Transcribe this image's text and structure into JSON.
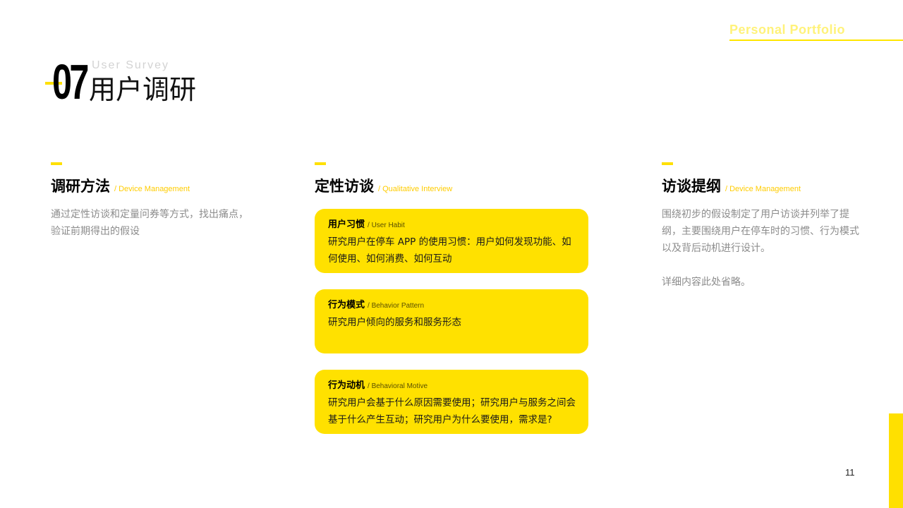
{
  "brand": {
    "text": "Personal Portfolio",
    "color": "#FFE600"
  },
  "section": {
    "number": "07",
    "subtitle_en": "User Survey",
    "title_cn": "用户调研"
  },
  "columns": [
    {
      "title": "调研方法",
      "subtitle": "/ Device Management",
      "paragraphs": [
        "通过定性访谈和定量问券等方式，找出痛点，验证前期得出的假设"
      ]
    },
    {
      "title": "定性访谈",
      "subtitle": "/ Qualitative Interview",
      "cards": [
        {
          "title": "用户习惯",
          "subtitle": "/ User Habit",
          "body": "研究用户在停车 APP 的使用习惯：用户如何发现功能、如何使用、如何消费、如何互动"
        },
        {
          "title": "行为模式",
          "subtitle": "/ Behavior Pattern",
          "body": "研究用户倾向的服务和服务形态"
        },
        {
          "title": "行为动机",
          "subtitle": "/ Behavioral Motive",
          "body": "研究用户会基于什么原因需要使用；研究用户与服务之间会基于什么产生互动；研究用户为什么要使用，需求是?"
        }
      ]
    },
    {
      "title": "访谈提纲",
      "subtitle": "/ Device Management",
      "paragraphs": [
        "围绕初步的假设制定了用户访谈并列举了提纲，主要围绕用户在停车时的习惯、行为模式以及背后动机进行设计。",
        "详细内容此处省略。"
      ]
    }
  ],
  "page_number": "11",
  "accent_color": "#FFE000"
}
